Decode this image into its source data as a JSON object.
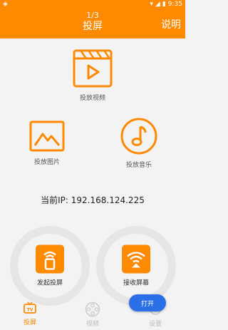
{
  "status": {
    "time": "9:35"
  },
  "appbar": {
    "counter": "1/3",
    "title": "投屏",
    "help": "说明"
  },
  "features": {
    "video": "投放视频",
    "image": "投放图片",
    "music": "投放音乐"
  },
  "ip": {
    "text": "当前IP: 192.168.124.225"
  },
  "actions": {
    "send": "发起投屏",
    "receive": "接收屏幕",
    "open": "打开"
  },
  "tabs": [
    {
      "label": "投屏",
      "icon": "tv-icon",
      "active": true
    },
    {
      "label": "视频",
      "icon": "film-reel-icon",
      "active": false
    },
    {
      "label": "设置",
      "icon": "gear-icon",
      "active": false
    }
  ],
  "colors": {
    "accent": "#ff8a00",
    "button": "#2b6fe8"
  }
}
